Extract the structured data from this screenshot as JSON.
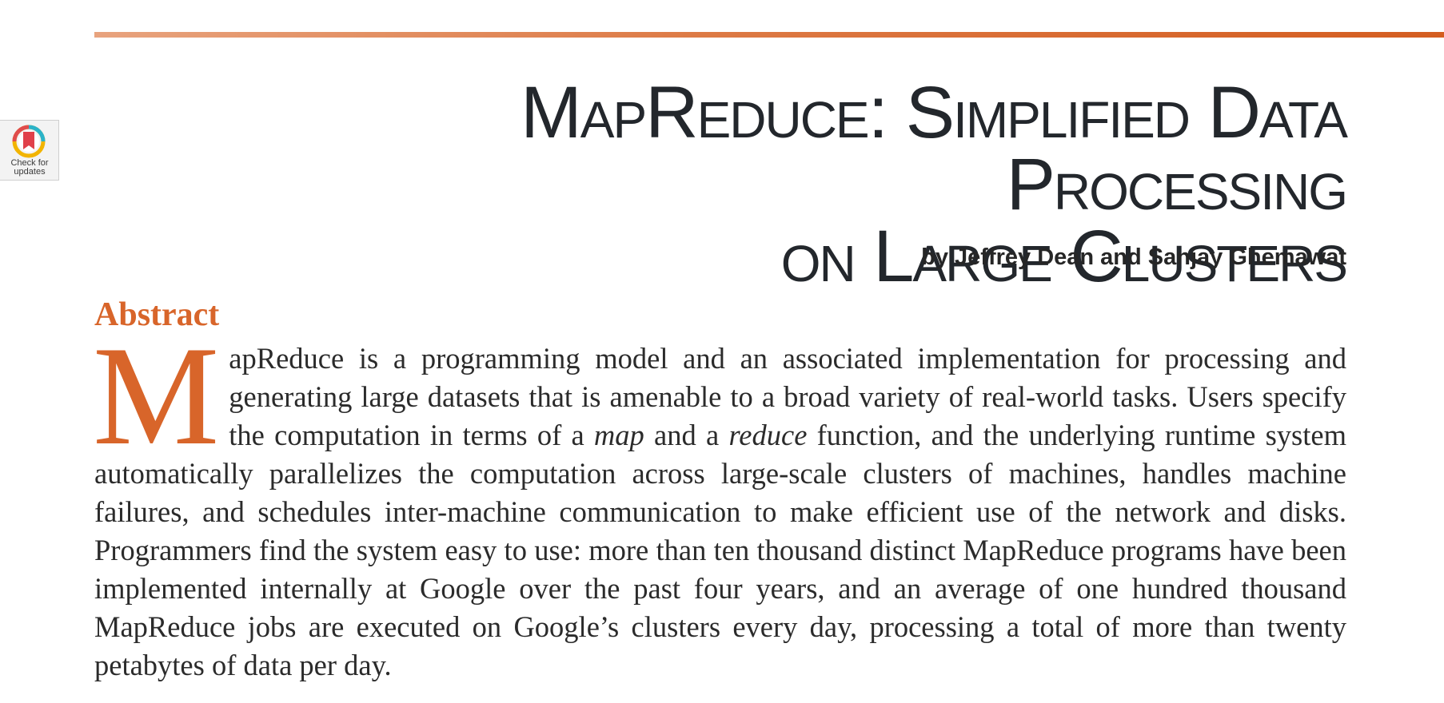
{
  "badge": {
    "text_line1": "Check for",
    "text_line2": "updates"
  },
  "article": {
    "title_line1": "MapReduce: Simplified Data Processing",
    "title_line2": "on Large Clusters",
    "authors": "by Jeffrey Dean and Sanjay Ghemawat",
    "abstract_heading": "Abstract",
    "abstract": {
      "dropcap": "M",
      "part1": "apReduce is a programming model and an associated implementation for processing and generating large datasets that is amenable to a broad variety of real-world tasks. Users specify the computation in terms of a ",
      "italic1": "map",
      "part2": " and a ",
      "italic2": "reduce",
      "part3": " function, and the underlying runtime system automatically parallelizes the computation across large-scale clusters of machines, handles machine failures, and schedules inter-machine communication to make efficient use of the network and disks. Programmers find the system easy to use: more than ten thousand distinct MapReduce programs have been implemented internally at Google over the past four years, and an average of one hundred thousand MapReduce jobs are executed on Google’s clusters every day, processing a total of more than twenty petabytes of data per day."
    }
  },
  "colors": {
    "accent": "#d8652a",
    "title": "#23272c",
    "text": "#2b2b2b"
  }
}
